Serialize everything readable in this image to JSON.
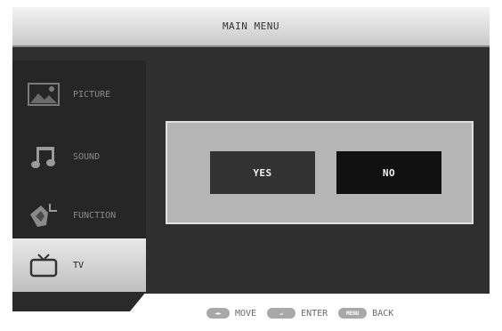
{
  "header": {
    "title": "MAIN MENU"
  },
  "sidebar": {
    "items": [
      {
        "label": "PICTURE",
        "icon": "picture-icon",
        "active": false
      },
      {
        "label": "SOUND",
        "icon": "music-note-icon",
        "active": false
      },
      {
        "label": "FUNCTION",
        "icon": "function-icon",
        "active": false
      },
      {
        "label": "TV",
        "icon": "tv-icon",
        "active": true
      }
    ]
  },
  "dialog": {
    "yes_label": "YES",
    "no_label": "NO"
  },
  "hints": {
    "move_key": "◄►",
    "move_label": "MOVE",
    "enter_key": "↵",
    "enter_label": "ENTER",
    "back_key": "MENU",
    "back_label": "BACK"
  },
  "colors": {
    "panel_bg": "#2f2f2f",
    "sidebar_bg": "#262626",
    "dialog_bg": "#b5b5b5",
    "yes_bg": "#323232",
    "no_bg": "#111111"
  }
}
